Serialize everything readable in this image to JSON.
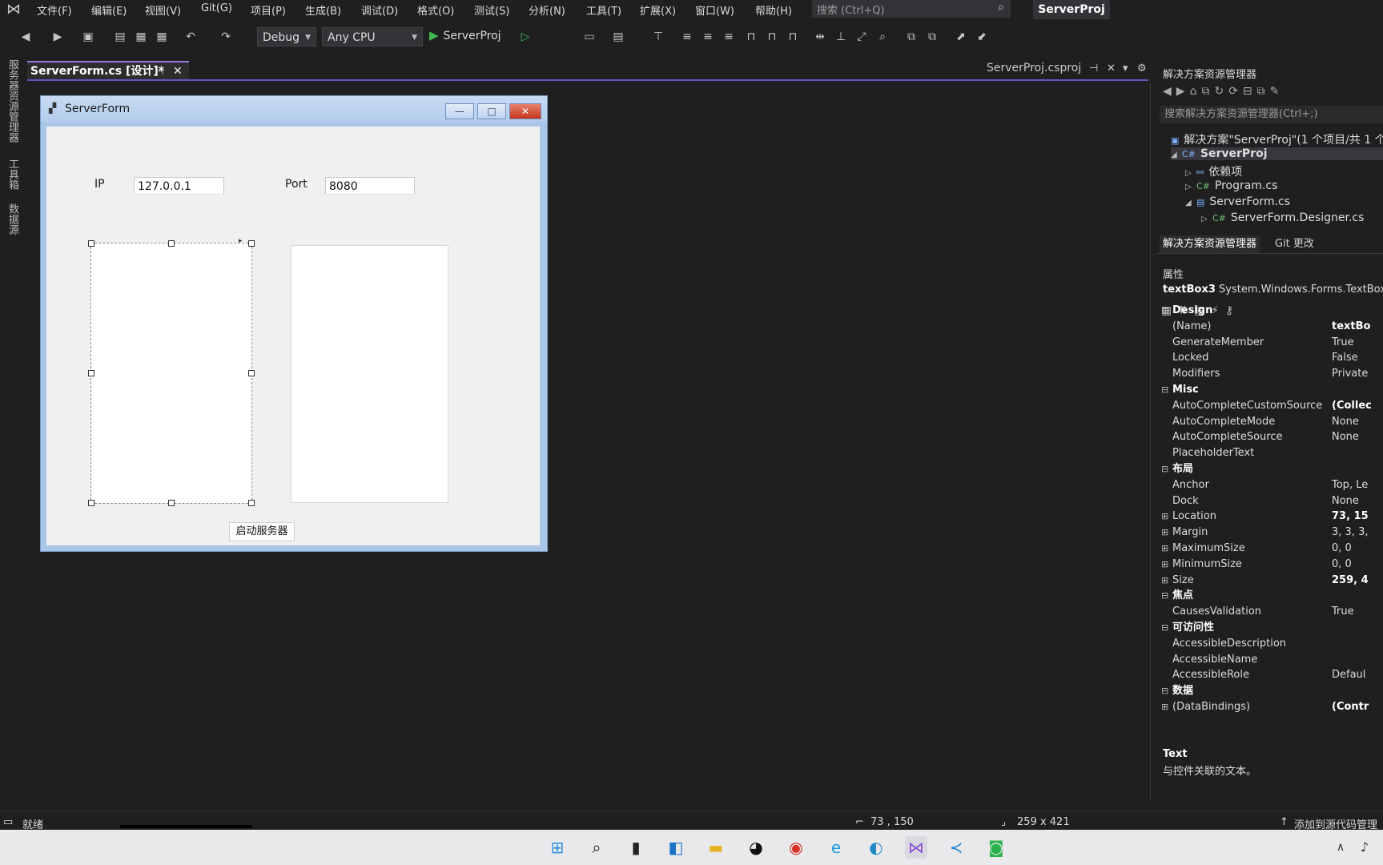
{
  "menu": {
    "items": [
      "文件(F)",
      "编辑(E)",
      "视图(V)",
      "Git(G)",
      "项目(P)",
      "生成(B)",
      "调试(D)",
      "格式(O)",
      "测试(S)",
      "分析(N)",
      "工具(T)",
      "扩展(X)",
      "窗口(W)",
      "帮助(H)"
    ],
    "search_placeholder": "搜索 (Ctrl+Q)",
    "project_badge": "ServerProj"
  },
  "toolbar": {
    "config": "Debug",
    "platform": "Any CPU",
    "run_target": "ServerProj"
  },
  "left_strip": [
    "服务器资源管理器",
    "工具箱",
    "数据源"
  ],
  "tabs": {
    "active": "ServerForm.cs [设计]*",
    "second": "ServerProj.csproj"
  },
  "form": {
    "title": "ServerForm",
    "ip_label": "IP",
    "ip_value": "127.0.0.1",
    "port_label": "Port",
    "port_value": "8080",
    "start_button": "启动服务器"
  },
  "solution_explorer": {
    "title": "解决方案资源管理器",
    "search": "搜索解决方案资源管理器(Ctrl+;)",
    "tree": [
      {
        "label": "解决方案\"ServerProj\"(1 个项目/共 1 个)"
      },
      {
        "label": "ServerProj"
      },
      {
        "label": "依赖项"
      },
      {
        "label": "Program.cs"
      },
      {
        "label": "ServerForm.cs"
      },
      {
        "label": "ServerForm.Designer.cs"
      }
    ],
    "tab_explorer": "解决方案资源管理器",
    "tab_git": "Git 更改"
  },
  "properties": {
    "title": "属性",
    "object_name": "textBox3",
    "object_type": "System.Windows.Forms.TextBox",
    "rows": [
      {
        "name": "Design",
        "value": "",
        "category": true
      },
      {
        "name": "(Name)",
        "value": "textBo",
        "bold": true
      },
      {
        "name": "GenerateMember",
        "value": "True"
      },
      {
        "name": "Locked",
        "value": "False"
      },
      {
        "name": "Modifiers",
        "value": "Private"
      },
      {
        "name": "Misc",
        "value": "",
        "category": true
      },
      {
        "name": "AutoCompleteCustomSource",
        "value": "(Collec",
        "bold": true
      },
      {
        "name": "AutoCompleteMode",
        "value": "None"
      },
      {
        "name": "AutoCompleteSource",
        "value": "None"
      },
      {
        "name": "PlaceholderText",
        "value": ""
      },
      {
        "name": "布局",
        "value": "",
        "category": true
      },
      {
        "name": "Anchor",
        "value": "Top, Le"
      },
      {
        "name": "Dock",
        "value": "None"
      },
      {
        "name": "Location",
        "value": "73, 15",
        "bold": true,
        "expand": true
      },
      {
        "name": "Margin",
        "value": "3, 3, 3,",
        "expand": true
      },
      {
        "name": "MaximumSize",
        "value": "0, 0",
        "expand": true
      },
      {
        "name": "MinimumSize",
        "value": "0, 0",
        "expand": true
      },
      {
        "name": "Size",
        "value": "259, 4",
        "bold": true,
        "expand": true
      },
      {
        "name": "焦点",
        "value": "",
        "category": true
      },
      {
        "name": "CausesValidation",
        "value": "True"
      },
      {
        "name": "可访问性",
        "value": "",
        "category": true
      },
      {
        "name": "AccessibleDescription",
        "value": ""
      },
      {
        "name": "AccessibleName",
        "value": ""
      },
      {
        "name": "AccessibleRole",
        "value": "Defaul"
      },
      {
        "name": "数据",
        "value": "",
        "category": true
      },
      {
        "name": "(DataBindings)",
        "value": "(Contr",
        "bold": true,
        "expand": true
      }
    ],
    "desc_title": "Text",
    "desc_text": "与控件关联的文本。"
  },
  "status": {
    "ready": "就绪",
    "location": "73 , 150",
    "size": "259 x 421",
    "source_control": "添加到源代码管理"
  },
  "colors": {
    "accent": "#6a51c2",
    "run": "#3fb950",
    "background": "#1f1f1f"
  }
}
